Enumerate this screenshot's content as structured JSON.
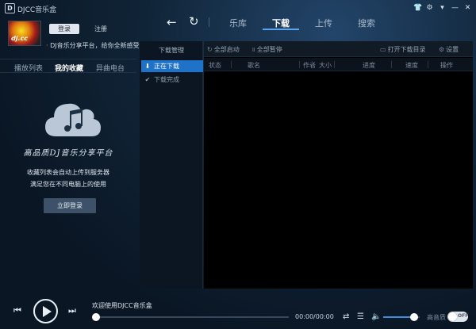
{
  "window": {
    "logo_letter": "D",
    "title": "DJCC音乐盒",
    "buttons": {
      "skin": "👕",
      "settings": "⚙",
      "minimize": "▾",
      "min2": "—",
      "close": "✕"
    }
  },
  "user": {
    "avatar_text": "dj.cc",
    "login_label": "登录",
    "register_label": "注册",
    "tagline": "DJ音乐分享平台，给你全新感受！"
  },
  "left_tabs": [
    {
      "label": "播放列表"
    },
    {
      "label": "我的收藏"
    },
    {
      "label": "异曲电台"
    }
  ],
  "left_panel": {
    "platform": "高品质DJ音乐分享平台",
    "desc1": "收藏列表会自动上传到服务器",
    "desc2": "满足您在不同电脑上的使用",
    "login_now": "立即登录"
  },
  "nav": {
    "back": "←",
    "refresh": "↻",
    "tabs": [
      {
        "label": "乐库"
      },
      {
        "label": "下载"
      },
      {
        "label": "上传"
      },
      {
        "label": "搜索"
      }
    ],
    "active_tab": "下载"
  },
  "download": {
    "title": "下载管理",
    "items": [
      {
        "icon": "⬇",
        "label": "正在下载"
      },
      {
        "icon": "✔",
        "label": "下载完成"
      }
    ],
    "toolbar": {
      "start_all": "全部启动",
      "pause_all": "全部暂停",
      "open_dir": "打开下载目录",
      "settings": "设置"
    },
    "columns": [
      "状态",
      "歌名",
      "作者",
      "大小",
      "进度",
      "速度",
      "操作"
    ]
  },
  "player": {
    "welcome": "欢迎使用DJCC音乐盒",
    "time": "00:00/00:00",
    "progress": 0,
    "volume": 0.85,
    "hq_label": "高音质",
    "hq_toggle": "OFF"
  },
  "colors": {
    "accent": "#1e72c7",
    "nav_underline": "#59a6ef",
    "volume_fill": "#3b8fdc"
  }
}
